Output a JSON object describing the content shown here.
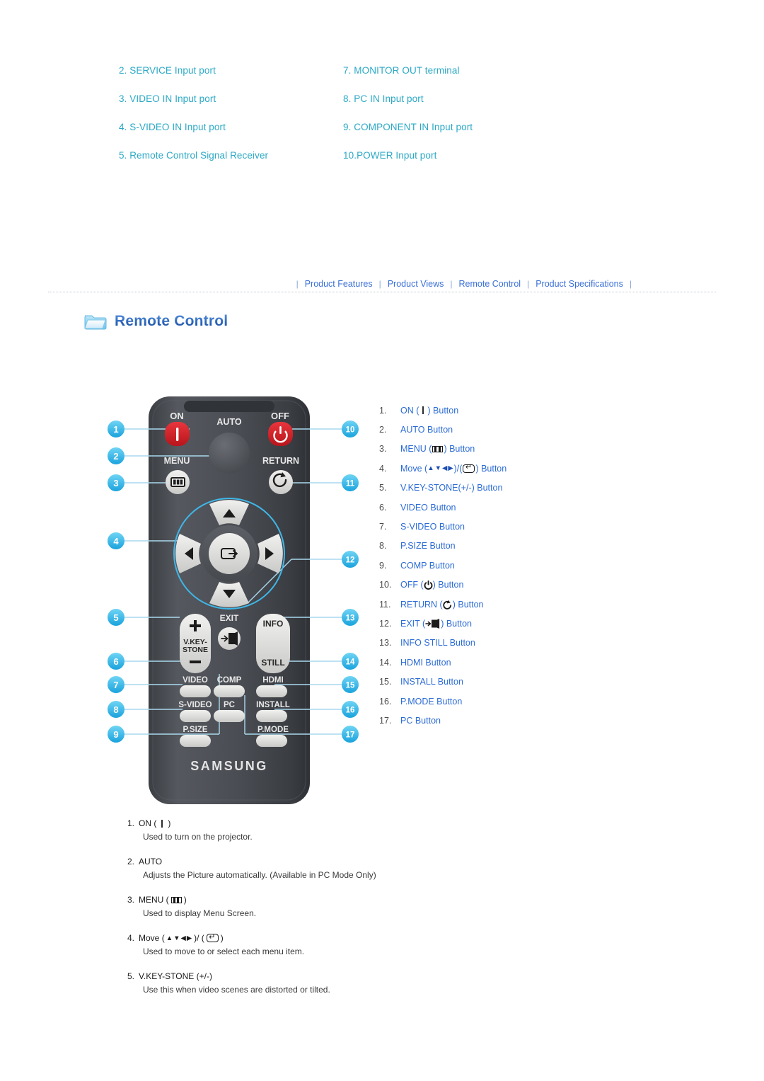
{
  "ports": {
    "left_column": [
      "2. SERVICE Input port",
      "3. VIDEO IN Input port",
      "4. S-VIDEO IN Input port",
      "5. Remote Control Signal Receiver"
    ],
    "right_column": [
      "7. MONITOR OUT terminal",
      "8. PC IN Input port",
      "9. COMPONENT IN Input port",
      "10.POWER Input port"
    ]
  },
  "nav": {
    "separator": "|",
    "items": [
      "Product Features",
      "Product Views",
      "Remote Control",
      "Product Specifications"
    ]
  },
  "section": {
    "icon": "folder-icon",
    "title": "Remote Control"
  },
  "remote": {
    "brand": "SAMSUNG",
    "labels": {
      "on": "ON",
      "off": "OFF",
      "auto": "AUTO",
      "menu": "MENU",
      "return": "RETURN",
      "vkeystone_line1": "V.KEY-",
      "vkeystone_line2": "STONE",
      "exit": "EXIT",
      "info": "INFO",
      "still": "STILL",
      "video": "VIDEO",
      "comp": "COMP",
      "hdmi": "HDMI",
      "svideo": "S-VIDEO",
      "pc": "PC",
      "install": "INSTALL",
      "psize": "P.SIZE",
      "pmode": "P.MODE",
      "plus": "+",
      "minus": "—"
    },
    "callouts_left": [
      "1",
      "2",
      "3",
      "4",
      "5",
      "6",
      "7",
      "8",
      "9"
    ],
    "callouts_right": [
      "10",
      "11",
      "12",
      "13",
      "14",
      "15",
      "16",
      "17"
    ]
  },
  "index_list": [
    {
      "num": "1.",
      "pre": "ON (",
      "icon": "power-on-bar-icon",
      "post": ") Button"
    },
    {
      "num": "2.",
      "pre": "AUTO Button",
      "icon": "",
      "post": ""
    },
    {
      "num": "3.",
      "pre": "MENU (",
      "icon": "menu-bars-icon",
      "post": ") Button"
    },
    {
      "num": "4.",
      "pre": "Move (",
      "icon": "dpad-arrows-icon",
      "post": ") Button"
    },
    {
      "num": "5.",
      "pre": "V.KEY-STONE(+/-) Button",
      "icon": "",
      "post": ""
    },
    {
      "num": "6.",
      "pre": "VIDEO Button",
      "icon": "",
      "post": ""
    },
    {
      "num": "7.",
      "pre": "S-VIDEO Button",
      "icon": "",
      "post": ""
    },
    {
      "num": "8.",
      "pre": "P.SIZE Button",
      "icon": "",
      "post": ""
    },
    {
      "num": "9.",
      "pre": "COMP Button",
      "icon": "",
      "post": ""
    },
    {
      "num": "10.",
      "pre": "OFF (",
      "icon": "power-off-icon",
      "post": ") Button"
    },
    {
      "num": "11.",
      "pre": "RETURN (",
      "icon": "return-arrow-icon",
      "post": ") Button"
    },
    {
      "num": "12.",
      "pre": "EXIT (",
      "icon": "exit-door-icon",
      "post": ") Button"
    },
    {
      "num": "13.",
      "pre": "INFO STILL Button",
      "icon": "",
      "post": ""
    },
    {
      "num": "14.",
      "pre": "HDMI Button",
      "icon": "",
      "post": ""
    },
    {
      "num": "15.",
      "pre": "INSTALL Button",
      "icon": "",
      "post": ""
    },
    {
      "num": "16.",
      "pre": "P.MODE Button",
      "icon": "",
      "post": ""
    },
    {
      "num": "17.",
      "pre": "PC Button",
      "icon": "",
      "post": ""
    }
  ],
  "descriptions": [
    {
      "num": "1.",
      "title_pre": "ON (",
      "title_post": ")",
      "icon": "power-on-bar-icon",
      "body": "Used to turn on the projector."
    },
    {
      "num": "2.",
      "title_pre": "AUTO",
      "title_post": "",
      "icon": "",
      "body": "Adjusts the Picture automatically. (Available in PC Mode Only)"
    },
    {
      "num": "3.",
      "title_pre": "MENU (",
      "title_post": ")",
      "icon": "menu-bars-icon",
      "body": "Used to display Menu Screen."
    },
    {
      "num": "4.",
      "title_pre": "Move (",
      "title_post": ")",
      "icon": "dpad-enter-icon",
      "body": "Used to move to or select each menu item."
    },
    {
      "num": "5.",
      "title_pre": "V.KEY-STONE (+/-)",
      "title_post": "",
      "icon": "",
      "body": "Use this when video scenes are distorted or tilted."
    }
  ],
  "colors": {
    "port_text": "#2ba9c6",
    "nav_link": "#3a6fd8",
    "section_title": "#2d6cc0",
    "index_label": "#2b6bd6",
    "callout": "#35b6e8",
    "remote_body": "#4a4d52",
    "power_red": "#d81f26"
  }
}
